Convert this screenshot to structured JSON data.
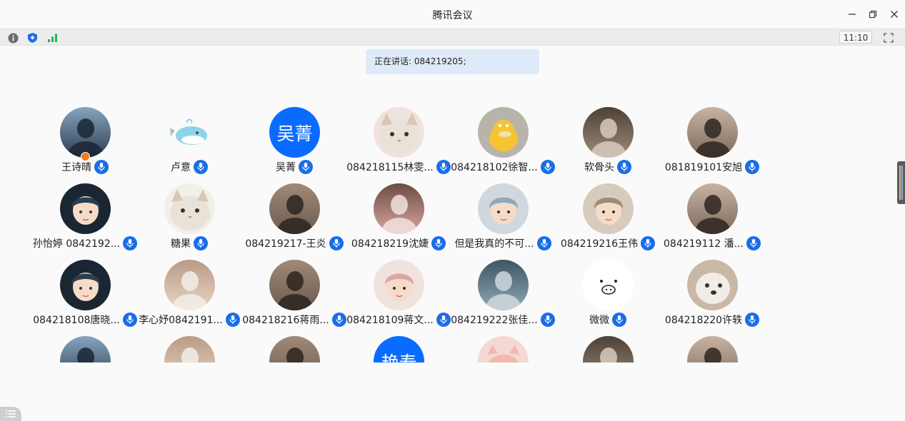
{
  "window": {
    "title": "腾讯会议",
    "minimize_icon": "minimize-icon",
    "restore_icon": "restore-icon",
    "close_icon": "close-icon"
  },
  "toolbar": {
    "info_icon": "info-icon",
    "security_icon": "shield-icon",
    "network_icon": "signal-icon",
    "time": "11:10",
    "fullscreen_icon": "fullscreen-icon"
  },
  "banner": {
    "speaking_text": "正在讲话: 084219205;"
  },
  "colors": {
    "accent": "#0a6cff",
    "mic": "#1a6de8",
    "banner_bg": "#dfeaf9"
  },
  "participants": [
    {
      "name": "王诗晴",
      "avatar": "photo",
      "host": true
    },
    {
      "name": "卢意",
      "avatar": "whale"
    },
    {
      "name": "吴菁",
      "avatar": "text",
      "avatar_text": "吴菁"
    },
    {
      "name": "084218115林雯...",
      "avatar": "cat"
    },
    {
      "name": "084218102徐智...",
      "avatar": "duck"
    },
    {
      "name": "软骨头",
      "avatar": "photo"
    },
    {
      "name": "081819101安旭",
      "avatar": "photo"
    },
    {
      "name": "孙怡婷 0842192...",
      "avatar": "cartoon"
    },
    {
      "name": "糖果",
      "avatar": "cat"
    },
    {
      "name": "084219217-王炎",
      "avatar": "photo"
    },
    {
      "name": "084218219沈婕",
      "avatar": "photo"
    },
    {
      "name": "但是我真的不可...",
      "avatar": "cartoon"
    },
    {
      "name": "084219216王伟",
      "avatar": "cartoon"
    },
    {
      "name": "084219112 潘...",
      "avatar": "photo"
    },
    {
      "name": "084218108唐晓...",
      "avatar": "cartoon"
    },
    {
      "name": "李心妤0842191...",
      "avatar": "photo"
    },
    {
      "name": "084218216蒋雨...",
      "avatar": "photo"
    },
    {
      "name": "084218109蒋文...",
      "avatar": "cartoon"
    },
    {
      "name": "084219222张佳...",
      "avatar": "photo"
    },
    {
      "name": "微微",
      "avatar": "pig-face"
    },
    {
      "name": "084218220许轶",
      "avatar": "dog"
    },
    {
      "name": "",
      "avatar": "photo"
    },
    {
      "name": "",
      "avatar": "photo"
    },
    {
      "name": "",
      "avatar": "photo"
    },
    {
      "name": "",
      "avatar": "text",
      "avatar_text": "艳寿"
    },
    {
      "name": "",
      "avatar": "pig"
    },
    {
      "name": "",
      "avatar": "photo"
    },
    {
      "name": "",
      "avatar": "photo"
    }
  ]
}
